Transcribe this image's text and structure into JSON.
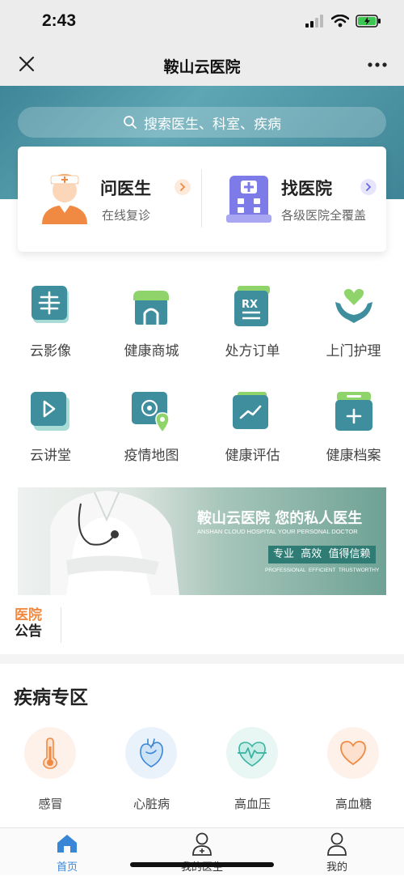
{
  "status_bar": {
    "time": "2:43"
  },
  "navbar": {
    "title": "鞍山云医院"
  },
  "search": {
    "placeholder": "搜索医生、科室、疾病"
  },
  "cards": [
    {
      "title": "问医生",
      "subtitle": "在线复诊",
      "accent": "#f08a42"
    },
    {
      "title": "找医院",
      "subtitle": "各级医院全覆盖",
      "accent": "#6b66e0"
    }
  ],
  "grid": [
    {
      "label": "云影像",
      "icon": "xray-icon"
    },
    {
      "label": "健康商城",
      "icon": "shop-icon"
    },
    {
      "label": "处方订单",
      "icon": "prescription-icon"
    },
    {
      "label": "上门护理",
      "icon": "care-hands-icon"
    },
    {
      "label": "云讲堂",
      "icon": "play-icon"
    },
    {
      "label": "疫情地图",
      "icon": "map-pin-icon"
    },
    {
      "label": "健康评估",
      "icon": "chart-icon"
    },
    {
      "label": "健康档案",
      "icon": "medical-folder-icon"
    }
  ],
  "banner": {
    "title": "鞍山云医院 您的私人医生",
    "subtitle": "ANSHAN CLOUD HOSPITAL YOUR PERSONAL DOCTOR",
    "tag": "专业  高效  值得信赖",
    "tag_en": "PROFESSIONAL  EFFICIENT  TRUSTWORTHY"
  },
  "notice": {
    "line1": "医院",
    "line2": "公告"
  },
  "disease_section": {
    "title": "疾病专区",
    "items": [
      {
        "label": "感冒",
        "icon": "thermometer-icon"
      },
      {
        "label": "心脏病",
        "icon": "heart-organ-icon"
      },
      {
        "label": "高血压",
        "icon": "heart-pulse-icon"
      },
      {
        "label": "高血糖",
        "icon": "heart-icon"
      }
    ]
  },
  "tabbar": [
    {
      "label": "首页",
      "icon": "home-icon",
      "active": true
    },
    {
      "label": "我的医生",
      "icon": "doctor-icon",
      "active": false
    },
    {
      "label": "我的",
      "icon": "profile-icon",
      "active": false
    }
  ],
  "colors": {
    "teal": "#3e8698",
    "active_tab": "#3a86d6",
    "orange": "#f08a42"
  }
}
